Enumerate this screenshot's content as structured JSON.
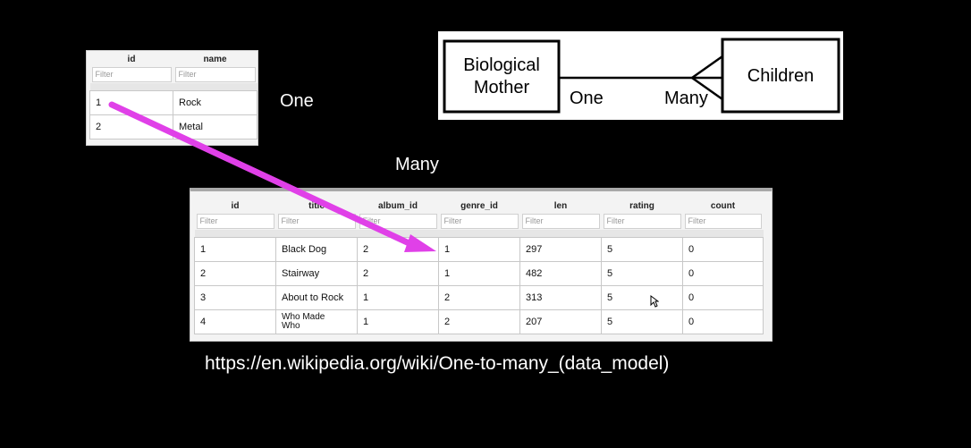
{
  "genre_table": {
    "columns": [
      "id",
      "name"
    ],
    "filter_placeholder": "Filter",
    "rows": [
      [
        "1",
        "Rock"
      ],
      [
        "2",
        "Metal"
      ]
    ]
  },
  "label_one": "One",
  "label_many": "Many",
  "track_table": {
    "columns": [
      "id",
      "title",
      "album_id",
      "genre_id",
      "len",
      "rating",
      "count"
    ],
    "filter_placeholder": "Filter",
    "rows": [
      [
        "1",
        "Black Dog",
        "2",
        "1",
        "297",
        "5",
        "0"
      ],
      [
        "2",
        "Stairway",
        "2",
        "1",
        "482",
        "5",
        "0"
      ],
      [
        "3",
        "About to Rock",
        "1",
        "2",
        "313",
        "5",
        "0"
      ],
      [
        "4",
        "Who Made Who",
        "1",
        "2",
        "207",
        "5",
        "0"
      ]
    ]
  },
  "er_diagram": {
    "left_entity_line1": "Biological",
    "left_entity_line2": "Mother",
    "right_entity": "Children",
    "left_cardinality": "One",
    "right_cardinality": "Many"
  },
  "url": "https://en.wikipedia.org/wiki/One-to-many_(data_model)",
  "colors": {
    "arrow": "#e040e8",
    "background": "#000000"
  }
}
